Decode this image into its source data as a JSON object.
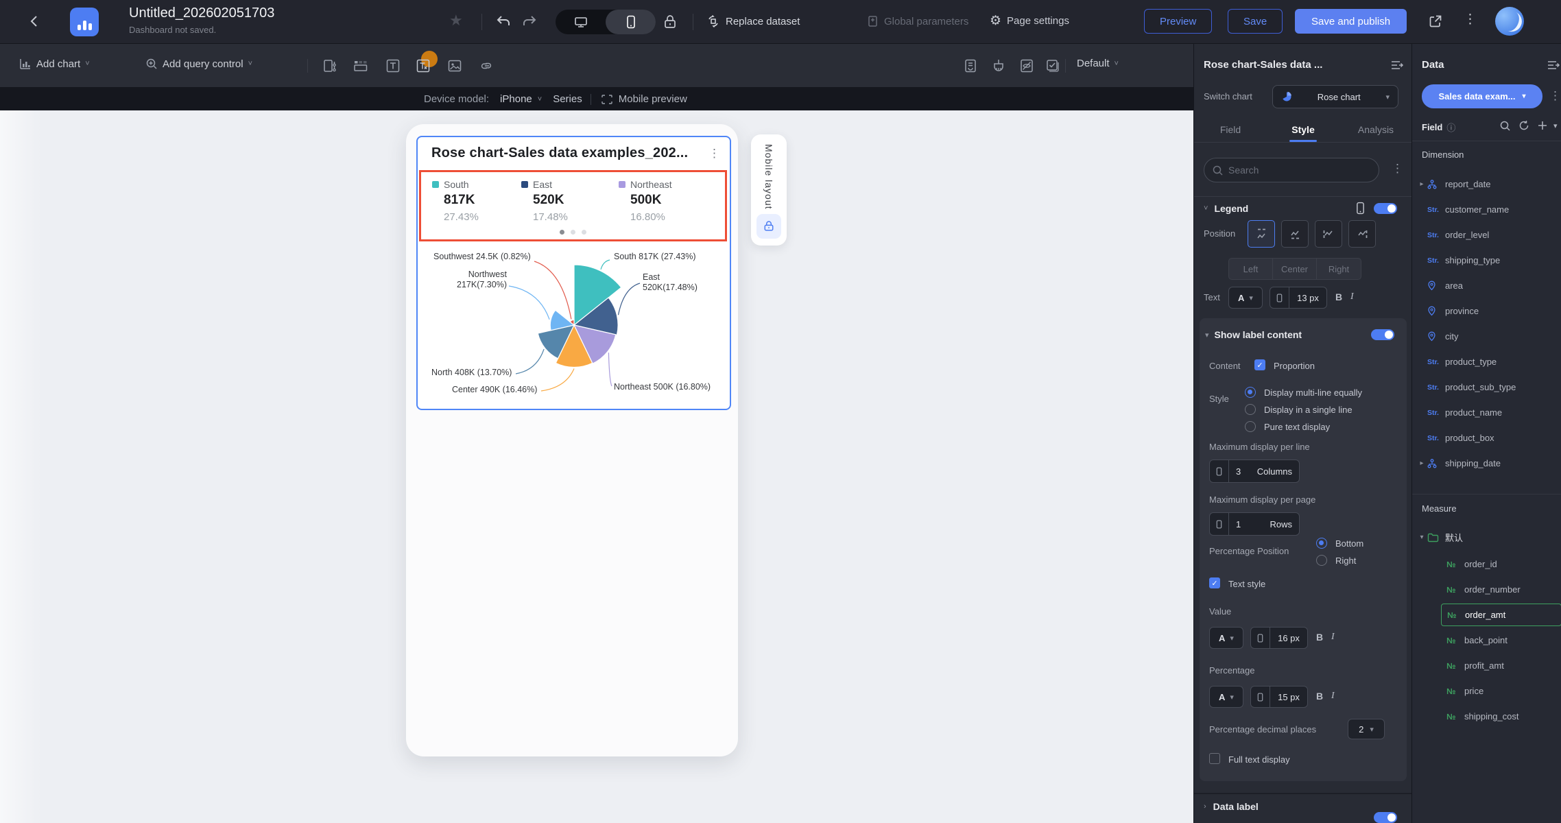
{
  "topbar": {
    "title": "Untitled_202602051703",
    "subtitle": "Dashboard not saved.",
    "replace_dataset": "Replace dataset",
    "global_parameters": "Global parameters",
    "page_settings": "Page settings",
    "preview": "Preview",
    "save": "Save",
    "save_and_publish": "Save and publish"
  },
  "toolbar": {
    "add_chart": "Add chart",
    "add_query_control": "Add query control",
    "default_label": "Default"
  },
  "device_bar": {
    "label": "Device model:",
    "model": "iPhone",
    "series": "Series",
    "mobile_preview": "Mobile preview"
  },
  "canvas": {
    "mobile_layout_tab": "Mobile layout"
  },
  "widget": {
    "title": "Rose chart-Sales data examples_202...",
    "legend_pages": 3,
    "active_page": 1,
    "legend_page": [
      {
        "name": "South",
        "value": "817K",
        "pct": "27.43%",
        "color": "#3fbfc0"
      },
      {
        "name": "East",
        "value": "520K",
        "pct": "17.48%",
        "color": "#2b4b7e"
      },
      {
        "name": "Northeast",
        "value": "500K",
        "pct": "16.80%",
        "color": "#a89ae0"
      }
    ]
  },
  "chart_data": {
    "type": "pie",
    "subtype": "nightingale-rose",
    "title": "Rose chart-Sales data examples",
    "legend_position": "top",
    "slices": [
      {
        "name": "South",
        "value": 817000,
        "pct": 27.43,
        "label": "South 817K (27.43%)",
        "color": "#3fbfbf"
      },
      {
        "name": "East",
        "value": 520000,
        "pct": 17.48,
        "label": "East\n520K(17.48%)",
        "color": "#41618f"
      },
      {
        "name": "Northeast",
        "value": 500000,
        "pct": 16.8,
        "label": "Northeast 500K (16.80%)",
        "color": "#a89bdc"
      },
      {
        "name": "Center",
        "value": 490000,
        "pct": 16.46,
        "label": "Center 490K (16.46%)",
        "color": "#f9a943"
      },
      {
        "name": "North",
        "value": 408000,
        "pct": 13.7,
        "label": "North 408K (13.70%)",
        "color": "#5586ab"
      },
      {
        "name": "Northwest",
        "value": 217000,
        "pct": 7.3,
        "label": "Northwest\n217K(7.30%)",
        "color": "#6fb5f3"
      },
      {
        "name": "Southwest",
        "value": 24500,
        "pct": 0.82,
        "label": "Southwest 24.5K (0.82%)",
        "color": "#e25b4c"
      }
    ]
  },
  "style_panel": {
    "title": "Rose chart-Sales data ...",
    "switch_chart_label": "Switch chart",
    "chart_type": "Rose chart",
    "tabs": [
      "Field",
      "Style",
      "Analysis"
    ],
    "active_tab": "Style",
    "search_placeholder": "Search",
    "legend_section": "Legend",
    "position_label": "Position",
    "align_options": [
      "Left",
      "Center",
      "Right"
    ],
    "text_label": "Text",
    "font_color_letter": "A",
    "text_font_size": "13 px",
    "bold_label": "B",
    "italic_label": "I",
    "show_label_content": "Show label content",
    "content_label": "Content",
    "proportion_label": "Proportion",
    "style_label": "Style",
    "label_style_options": [
      "Display multi-line equally",
      "Display in a single line",
      "Pure text display"
    ],
    "selected_label_style": "Display multi-line equally",
    "max_per_line_label": "Maximum display per line",
    "max_per_line_value": "3",
    "max_per_line_unit": "Columns",
    "max_per_page_label": "Maximum display per page",
    "max_per_page_value": "1",
    "max_per_page_unit": "Rows",
    "percentage_position_label": "Percentage Position",
    "percentage_position_options": [
      "Bottom",
      "Right"
    ],
    "selected_percentage_position": "Bottom",
    "text_style_label": "Text style",
    "value_label": "Value",
    "value_font_size": "16 px",
    "percentage_label": "Percentage",
    "percentage_font_size": "15 px",
    "decimal_places_label": "Percentage decimal places",
    "decimal_places_value": "2",
    "full_text_display_label": "Full text display",
    "data_label_section": "Data label"
  },
  "data_panel": {
    "title": "Data",
    "dataset_name": "Sales data exam...",
    "field_label": "Field",
    "dimension_label": "Dimension",
    "measure_label": "Measure",
    "measure_folder": "默认",
    "dimension_fields": [
      {
        "label": "report_date",
        "icon": "tree",
        "caret": true
      },
      {
        "label": "customer_name",
        "icon": "str"
      },
      {
        "label": "order_level",
        "icon": "str"
      },
      {
        "label": "shipping_type",
        "icon": "str"
      },
      {
        "label": "area",
        "icon": "geo"
      },
      {
        "label": "province",
        "icon": "geo"
      },
      {
        "label": "city",
        "icon": "geo"
      },
      {
        "label": "product_type",
        "icon": "str"
      },
      {
        "label": "product_sub_type",
        "icon": "str"
      },
      {
        "label": "product_name",
        "icon": "str"
      },
      {
        "label": "product_box",
        "icon": "str"
      },
      {
        "label": "shipping_date",
        "icon": "tree",
        "caret": true
      }
    ],
    "measure_fields": [
      {
        "label": "order_id"
      },
      {
        "label": "order_number"
      },
      {
        "label": "order_amt",
        "selected": true
      },
      {
        "label": "back_point"
      },
      {
        "label": "profit_amt"
      },
      {
        "label": "price"
      },
      {
        "label": "shipping_cost"
      }
    ]
  },
  "icons": {
    "string_field_glyph": "Str.",
    "numeric_field_glyph": "№"
  },
  "colors": {
    "accent_blue": "#4d7df2",
    "highlight_red": "#ee4e36",
    "measure_green": "#3da05f",
    "publish_blue": "#5c80f0"
  }
}
